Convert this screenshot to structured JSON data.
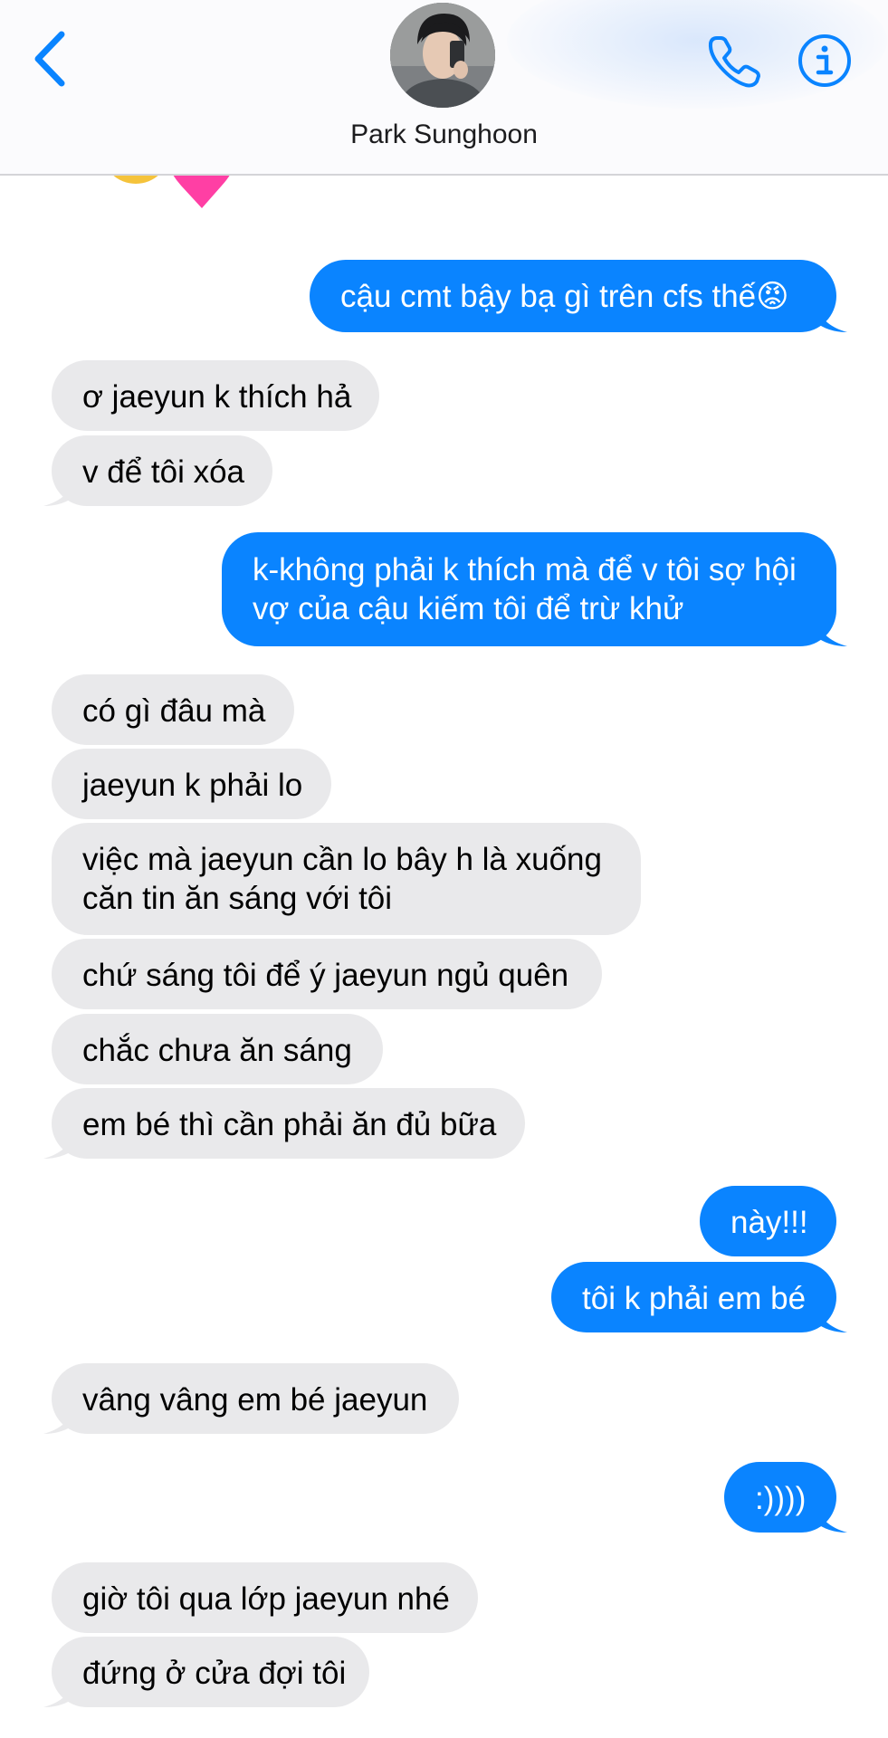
{
  "header": {
    "contact_name": "Park Sunghoon",
    "back_icon": "chevron-left-icon",
    "call_icon": "phone-icon",
    "info_icon": "info-icon",
    "accent_color": "#0a84ff"
  },
  "colors": {
    "outgoing_bubble": "#0a84ff",
    "incoming_bubble": "#e9e9eb"
  },
  "messages": [
    {
      "dir": "out",
      "text": "cậu cmt bậy bạ gì trên cfs thế😡"
    },
    {
      "dir": "in",
      "text": "ơ jaeyun k thích hả"
    },
    {
      "dir": "in",
      "text": "v để tôi xóa"
    },
    {
      "dir": "out",
      "text": "k-không phải k thích mà để v tôi sợ hội vợ của cậu kiếm tôi để trừ khử"
    },
    {
      "dir": "in",
      "text": "có gì đâu mà"
    },
    {
      "dir": "in",
      "text": "jaeyun k phải lo"
    },
    {
      "dir": "in",
      "text": "việc mà jaeyun cần lo bây h là xuống căn tin ăn sáng với tôi"
    },
    {
      "dir": "in",
      "text": "chứ sáng tôi để ý jaeyun ngủ quên"
    },
    {
      "dir": "in",
      "text": "chắc chưa ăn sáng"
    },
    {
      "dir": "in",
      "text": "em bé thì cần phải ăn đủ bữa"
    },
    {
      "dir": "out",
      "text": "này!!!"
    },
    {
      "dir": "out",
      "text": "tôi k phải em bé"
    },
    {
      "dir": "in",
      "text": "vâng vâng em bé jaeyun"
    },
    {
      "dir": "out",
      "text": ":))))"
    },
    {
      "dir": "in",
      "text": "giờ tôi qua lớp jaeyun nhé"
    },
    {
      "dir": "in",
      "text": "đứng ở cửa đợi tôi"
    }
  ],
  "message_lines": {
    "m3_line1": "k-không phải k thích mà để v tôi sợ hội",
    "m3_line2": "vợ của cậu kiếm tôi để trừ khử",
    "m6_line1": "việc mà jaeyun cần lo bây h là xuống",
    "m6_line2": "căn tin ăn sáng với tôi"
  }
}
